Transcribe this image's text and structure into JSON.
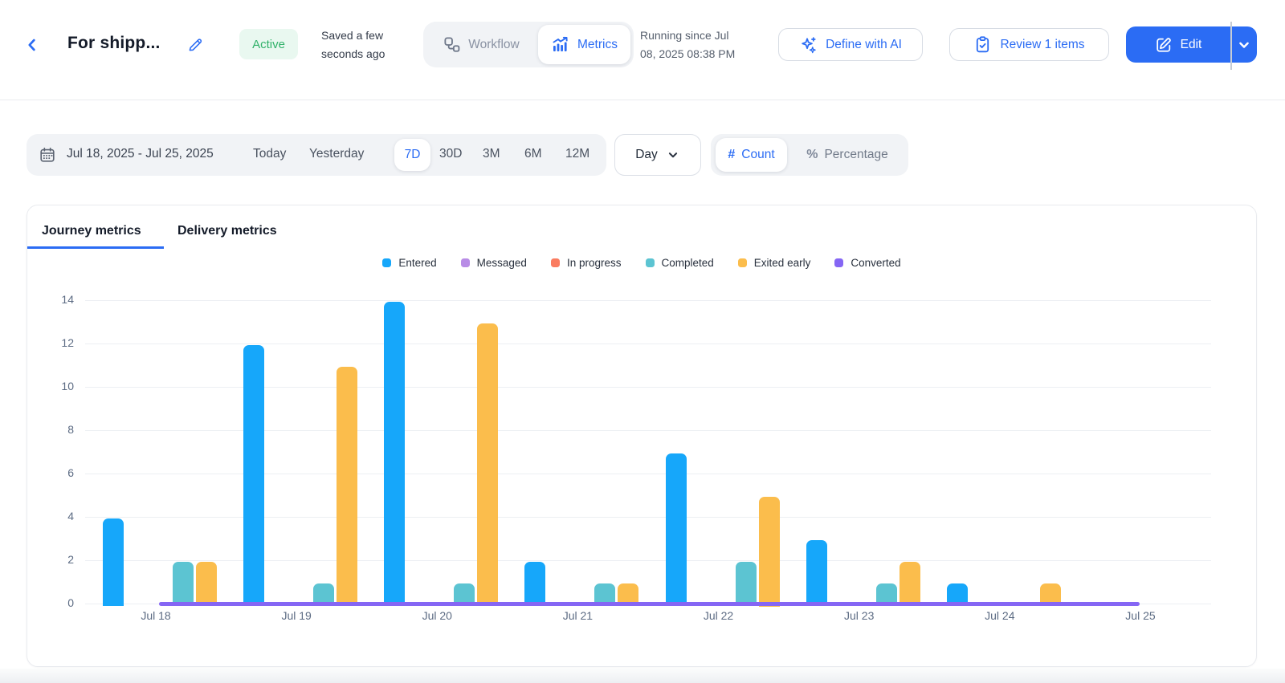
{
  "colors": {
    "accent_blue": "#2B6CF4",
    "active_green": "#30B169",
    "active_green_bg": "#E9F8F0",
    "pill_gray": "#F1F3F6",
    "text_dark": "#141B29",
    "text_gray": "#8A92A3",
    "axis_text": "#5C6B83",
    "grid_line": "#ECEFF3"
  },
  "header": {
    "title": "For shipp...",
    "status_badge": "Active",
    "saved_text": "Saved a few seconds ago",
    "workflow_label": "Workflow",
    "metrics_label": "Metrics",
    "active_view": "Metrics",
    "running_since": "Running since Jul 08, 2025 08:38 PM",
    "define_ai_label": "Define with AI",
    "review_label": "Review 1 items",
    "edit_label": "Edit"
  },
  "filters": {
    "date_range": "Jul 18, 2025 - Jul 25, 2025",
    "presets": [
      "Today",
      "Yesterday",
      "7D",
      "30D",
      "3M",
      "6M",
      "12M"
    ],
    "active_preset": "7D",
    "granularity": "Day",
    "count_label": "Count",
    "percentage_label": "Percentage",
    "active_mode": "Count",
    "count_icon": "#",
    "percentage_icon": "%"
  },
  "tabs": {
    "journey": "Journey metrics",
    "delivery": "Delivery metrics",
    "active": "Journey metrics"
  },
  "chart_data": {
    "type": "bar",
    "title": "Journey metrics",
    "categories": [
      "Jul 18",
      "Jul 19",
      "Jul 20",
      "Jul 21",
      "Jul 22",
      "Jul 23",
      "Jul 24",
      "Jul 25"
    ],
    "series": [
      {
        "name": "Entered",
        "color": "#16A7FA",
        "values": [
          4,
          12,
          14,
          2,
          7,
          3,
          1,
          0
        ]
      },
      {
        "name": "Messaged",
        "color": "#B88CE6",
        "values": [
          0,
          0,
          0,
          0,
          0,
          0,
          0,
          0
        ]
      },
      {
        "name": "In progress",
        "color": "#FA7C60",
        "values": [
          0,
          0,
          0,
          0,
          0,
          0,
          0,
          0
        ]
      },
      {
        "name": "Completed",
        "color": "#5CC4D2",
        "values": [
          2,
          1,
          1,
          1,
          2,
          1,
          0,
          0
        ]
      },
      {
        "name": "Exited early",
        "color": "#FBBD4C",
        "values": [
          2,
          11,
          13,
          1,
          5,
          2,
          1,
          0
        ]
      },
      {
        "name": "Converted",
        "color": "#8566F4",
        "values": [
          0,
          0,
          0,
          0,
          0,
          0,
          0,
          0
        ],
        "render_as": "zero-line"
      }
    ],
    "ylim": [
      0,
      14
    ],
    "yticks": [
      0,
      2,
      4,
      6,
      8,
      10,
      12,
      14
    ],
    "grid": true,
    "legend_position": "top",
    "xlabel": "",
    "ylabel": ""
  }
}
